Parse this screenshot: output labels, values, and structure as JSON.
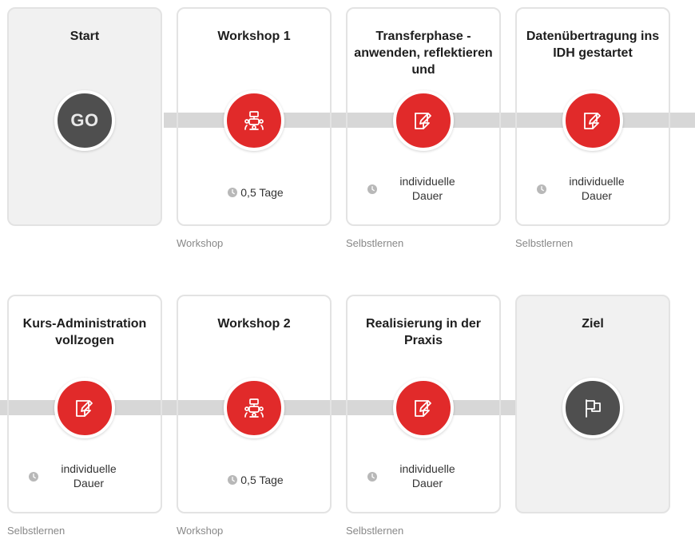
{
  "rows": [
    {
      "cards": [
        {
          "title": "Start",
          "node": "GO",
          "duration": "",
          "caption": ""
        },
        {
          "title": "Workshop 1",
          "node": "workshop-icon",
          "duration": "0,5 Tage",
          "caption": "Workshop"
        },
        {
          "title": "Transferphase - anwenden, reflektieren und",
          "node": "edit-icon",
          "duration_line1": "individuelle",
          "duration_line2": "Dauer",
          "caption": "Selbstlernen"
        },
        {
          "title": "Datenübertragung ins IDH gestartet",
          "node": "edit-icon",
          "duration_line1": "individuelle",
          "duration_line2": "Dauer",
          "caption": "Selbstlernen"
        }
      ]
    },
    {
      "cards": [
        {
          "title": "Kurs-Administration vollzogen",
          "node": "edit-icon",
          "duration_line1": "individuelle",
          "duration_line2": "Dauer",
          "caption": "Selbstlernen"
        },
        {
          "title": "Workshop 2",
          "node": "workshop-icon",
          "duration": "0,5 Tage",
          "caption": "Workshop"
        },
        {
          "title": "Realisierung in der Praxis",
          "node": "edit-icon",
          "duration_line1": "individuelle",
          "duration_line2": "Dauer",
          "caption": "Selbstlernen"
        },
        {
          "title": "Ziel",
          "node": "flag-icon",
          "duration": "",
          "caption": ""
        }
      ]
    }
  ],
  "colors": {
    "accent": "#e12a2a",
    "dark_node": "#4f4f4f",
    "track": "#d7d7d7",
    "card_border": "#e3e3e3",
    "card_grey": "#f1f1f1"
  }
}
